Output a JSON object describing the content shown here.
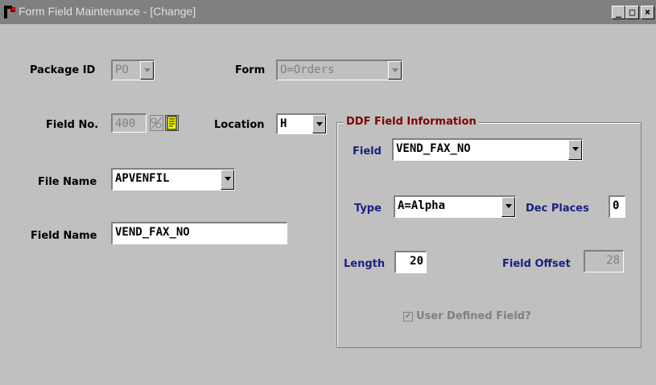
{
  "window": {
    "title": "Form Field Maintenance - [Change]",
    "minimize": "_",
    "maximize": "□",
    "close": "×"
  },
  "form": {
    "package_id_label": "Package ID",
    "package_id_value": "PO",
    "form_label": "Form",
    "form_value": "O=Orders",
    "field_no_label": "Field No.",
    "field_no_value": "400",
    "location_label": "Location",
    "location_value": "H",
    "file_name_label": "File Name",
    "file_name_value": "APVENFIL",
    "field_name_label": "Field Name",
    "field_name_value": "VEND_FAX_NO"
  },
  "ddf": {
    "group_title": "DDF Field Information",
    "field_label": "Field",
    "field_value": "VEND_FAX_NO",
    "type_label": "Type",
    "type_value": "A=Alpha",
    "dec_places_label": "Dec Places",
    "dec_places_value": "0",
    "length_label": "Length",
    "length_value": "20",
    "field_offset_label": "Field Offset",
    "field_offset_value": "28",
    "user_defined_label": "User Defined Field?",
    "user_defined_checked": true
  }
}
